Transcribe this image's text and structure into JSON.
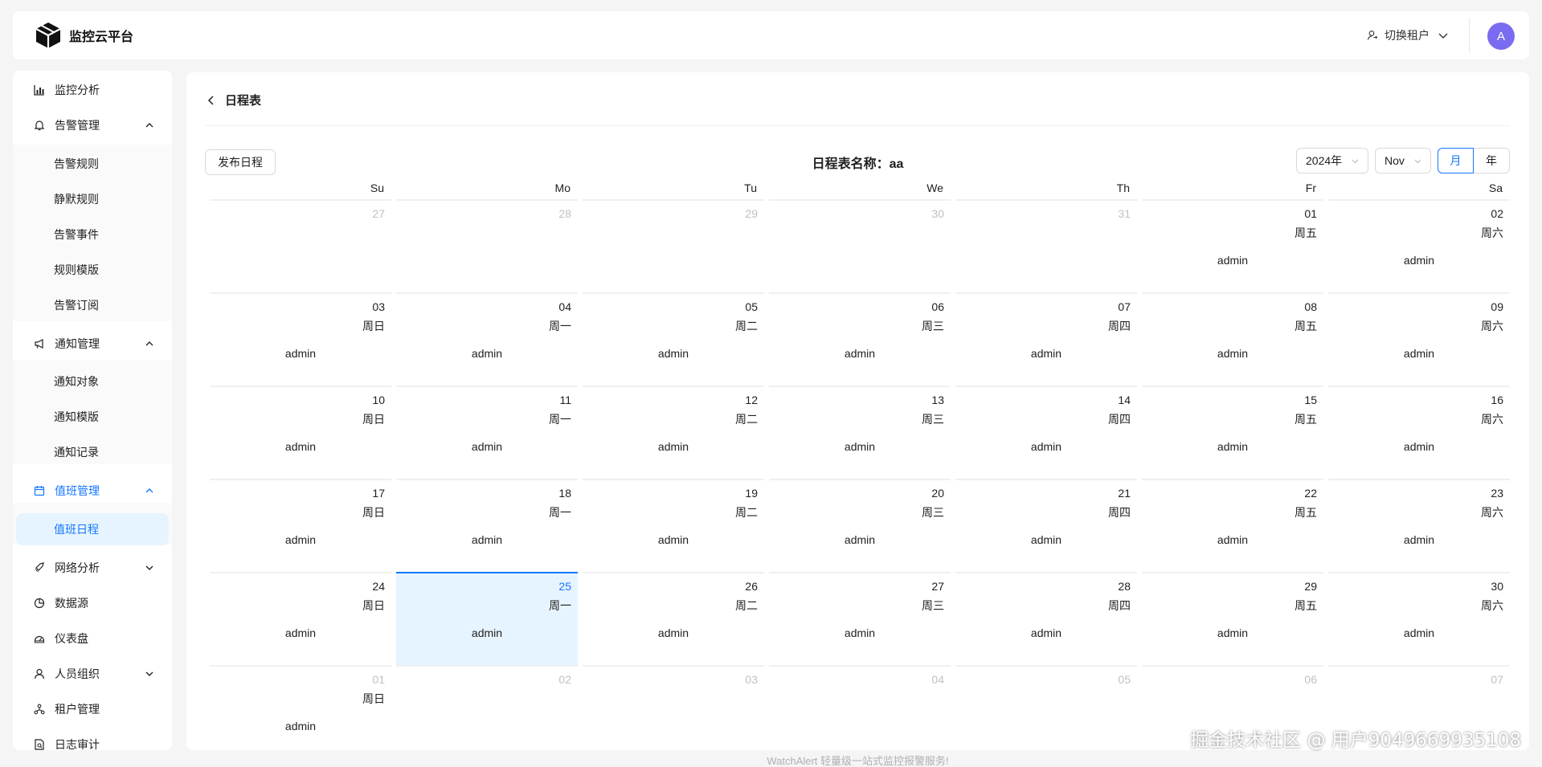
{
  "app": {
    "title": "监控云平台"
  },
  "header": {
    "tenant_label": "切换租户",
    "avatar_letter": "A"
  },
  "sidebar": {
    "items": [
      {
        "label": "监控分析"
      },
      {
        "label": "告警管理"
      },
      {
        "label": "告警规则"
      },
      {
        "label": "静默规则"
      },
      {
        "label": "告警事件"
      },
      {
        "label": "规则模版"
      },
      {
        "label": "告警订阅"
      },
      {
        "label": "通知管理"
      },
      {
        "label": "通知对象"
      },
      {
        "label": "通知模版"
      },
      {
        "label": "通知记录"
      },
      {
        "label": "值班管理"
      },
      {
        "label": "值班日程"
      },
      {
        "label": "网络分析"
      },
      {
        "label": "数据源"
      },
      {
        "label": "仪表盘"
      },
      {
        "label": "人员组织"
      },
      {
        "label": "租户管理"
      },
      {
        "label": "日志审计"
      }
    ]
  },
  "main": {
    "title": "日程表",
    "publish_button": "发布日程",
    "schedule_name": "日程表名称：aa",
    "year_select": "2024年",
    "month_select": "Nov",
    "mode_month": "月",
    "mode_year": "年"
  },
  "calendar": {
    "weekdays": [
      "Su",
      "Mo",
      "Tu",
      "We",
      "Th",
      "Fr",
      "Sa"
    ],
    "weeks": [
      [
        {
          "d": "27",
          "other": true
        },
        {
          "d": "28",
          "other": true
        },
        {
          "d": "29",
          "other": true
        },
        {
          "d": "30",
          "other": true
        },
        {
          "d": "31",
          "other": true
        },
        {
          "d": "01",
          "w": "周五",
          "e": "admin"
        },
        {
          "d": "02",
          "w": "周六",
          "e": "admin"
        }
      ],
      [
        {
          "d": "03",
          "w": "周日",
          "e": "admin"
        },
        {
          "d": "04",
          "w": "周一",
          "e": "admin"
        },
        {
          "d": "05",
          "w": "周二",
          "e": "admin"
        },
        {
          "d": "06",
          "w": "周三",
          "e": "admin"
        },
        {
          "d": "07",
          "w": "周四",
          "e": "admin"
        },
        {
          "d": "08",
          "w": "周五",
          "e": "admin"
        },
        {
          "d": "09",
          "w": "周六",
          "e": "admin"
        }
      ],
      [
        {
          "d": "10",
          "w": "周日",
          "e": "admin"
        },
        {
          "d": "11",
          "w": "周一",
          "e": "admin"
        },
        {
          "d": "12",
          "w": "周二",
          "e": "admin"
        },
        {
          "d": "13",
          "w": "周三",
          "e": "admin"
        },
        {
          "d": "14",
          "w": "周四",
          "e": "admin"
        },
        {
          "d": "15",
          "w": "周五",
          "e": "admin"
        },
        {
          "d": "16",
          "w": "周六",
          "e": "admin"
        }
      ],
      [
        {
          "d": "17",
          "w": "周日",
          "e": "admin"
        },
        {
          "d": "18",
          "w": "周一",
          "e": "admin"
        },
        {
          "d": "19",
          "w": "周二",
          "e": "admin"
        },
        {
          "d": "20",
          "w": "周三",
          "e": "admin"
        },
        {
          "d": "21",
          "w": "周四",
          "e": "admin"
        },
        {
          "d": "22",
          "w": "周五",
          "e": "admin"
        },
        {
          "d": "23",
          "w": "周六",
          "e": "admin"
        }
      ],
      [
        {
          "d": "24",
          "w": "周日",
          "e": "admin"
        },
        {
          "d": "25",
          "w": "周一",
          "e": "admin",
          "today": true
        },
        {
          "d": "26",
          "w": "周二",
          "e": "admin"
        },
        {
          "d": "27",
          "w": "周三",
          "e": "admin"
        },
        {
          "d": "28",
          "w": "周四",
          "e": "admin"
        },
        {
          "d": "29",
          "w": "周五",
          "e": "admin"
        },
        {
          "d": "30",
          "w": "周六",
          "e": "admin"
        }
      ],
      [
        {
          "d": "01",
          "w": "周日",
          "e": "admin",
          "other": true
        },
        {
          "d": "02",
          "other": true
        },
        {
          "d": "03",
          "other": true
        },
        {
          "d": "04",
          "other": true
        },
        {
          "d": "05",
          "other": true
        },
        {
          "d": "06",
          "other": true
        },
        {
          "d": "07",
          "other": true
        }
      ]
    ]
  },
  "footer": {
    "text": "WatchAlert 轻量级一站式监控报警服务!"
  },
  "watermark": {
    "text": "掘金技术社区 @ 用户9049669935108"
  },
  "colors": {
    "accent": "#1677ff",
    "avatar": "#7a6cf0",
    "selected_bg": "#e6f4ff"
  }
}
